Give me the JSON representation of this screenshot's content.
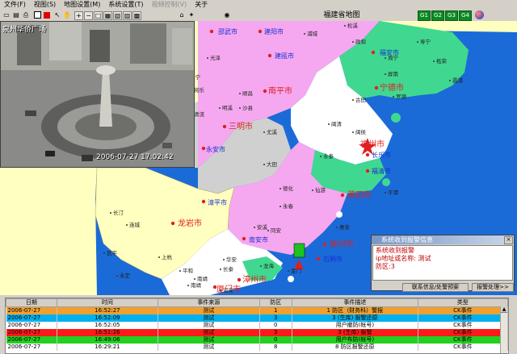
{
  "menu": [
    "文件(F)",
    "视图(S)",
    "地图设置(M)",
    "系统设置(T)",
    "视频控制(V)",
    "关于"
  ],
  "toolbar": {
    "icons": [
      "open-icon",
      "save-icon",
      "print-icon",
      "stop-icon",
      "record-icon",
      "pointer-icon",
      "pan-icon",
      "zoom-in-icon",
      "zoom-out-icon",
      "full-extent-icon",
      "layer-icon",
      "measure-icon",
      "identify-icon",
      "select-icon",
      "refresh-icon",
      "camera-icon",
      "target-icon"
    ],
    "map_title": "福建省地图",
    "green_buttons": [
      "G1",
      "G2",
      "G3",
      "G4"
    ]
  },
  "map": {
    "cities": [
      {
        "name": "邵武市",
        "color": "#1a2fd0"
      },
      {
        "name": "建阳市",
        "color": "#1a2fd0"
      },
      {
        "name": "建瓯市",
        "color": "#1a2fd0"
      },
      {
        "name": "福安市",
        "color": "#1a2fd0"
      },
      {
        "name": "南平市",
        "color": "#e02020"
      },
      {
        "name": "宁德市",
        "color": "#e02020"
      },
      {
        "name": "三明市",
        "color": "#e02020"
      },
      {
        "name": "永安市",
        "color": "#1a2fd0"
      },
      {
        "name": "福州市",
        "color": "#e02020"
      },
      {
        "name": "长乐市",
        "color": "#1a2fd0"
      },
      {
        "name": "福清市",
        "color": "#1a2fd0"
      },
      {
        "name": "莆田市",
        "color": "#e02020"
      },
      {
        "name": "漳平市",
        "color": "#1a2fd0"
      },
      {
        "name": "龙岩市",
        "color": "#e02020"
      },
      {
        "name": "泉州市",
        "color": "#e02020"
      },
      {
        "name": "南安市",
        "color": "#1a2fd0"
      },
      {
        "name": "石狮市",
        "color": "#1a2fd0"
      },
      {
        "name": "漳州市",
        "color": "#e02020"
      },
      {
        "name": "厦门市",
        "color": "#e02020"
      }
    ],
    "counties": [
      "松溪",
      "政和",
      "寿宁",
      "浦城",
      "光泽",
      "柘荣",
      "周宁",
      "霞浦",
      "屏南",
      "建宁",
      "泰宁",
      "将乐",
      "顺昌",
      "古田",
      "罗源",
      "闽清",
      "沙县",
      "尤溪",
      "闽侯",
      "宁化",
      "清流",
      "明溪",
      "永泰",
      "平潭",
      "大田",
      "德化",
      "永春",
      "仙游",
      "长汀",
      "连城",
      "安溪",
      "惠安",
      "武平",
      "上杭",
      "华安",
      "同安",
      "永定",
      "平和",
      "长泰",
      "南靖",
      "龙海",
      "南靖",
      "诏安",
      "金门"
    ]
  },
  "camera": {
    "label": "泉州华侨广场",
    "timestamp": "2006-07-27 17:02:42"
  },
  "alarm": {
    "title": "系统收到报警信息",
    "lines": [
      "系统收到报警",
      "ip地址或名称: 测试",
      "防区:3"
    ],
    "button1": "联系信息/处警预案",
    "button2": "报警处理>>"
  },
  "grid": {
    "headers": [
      "日期",
      "时间",
      "事件来源",
      "防区",
      "事件描述",
      "类型"
    ],
    "rows": [
      {
        "date": "2006-07-27",
        "time": "16:52:27",
        "source": "测试",
        "zone": "1",
        "desc": "1 防区（财务科）警报",
        "type": "CK事件",
        "bg": "#f0a030",
        "fg": "#000000"
      },
      {
        "date": "2006-07-27",
        "time": "16:52:09",
        "source": "测试",
        "zone": "3",
        "desc": "3 (生库) 报警还原",
        "type": "CK事件",
        "bg": "#00b0f0",
        "fg": "#000000"
      },
      {
        "date": "2006-07-27",
        "time": "16:52:05",
        "source": "测试",
        "zone": "0",
        "desc": "用户撤防(帐号)",
        "type": "CK事件",
        "bg": "#ffffff",
        "fg": "#000000"
      },
      {
        "date": "2006-07-27",
        "time": "16:51:26",
        "source": "测试",
        "zone": "3",
        "desc": "3 (生库) 报警",
        "type": "CK事件",
        "bg": "#ff1a1a",
        "fg": "#000000"
      },
      {
        "date": "2006-07-27",
        "time": "16:49:06",
        "source": "测试",
        "zone": "0",
        "desc": "用户布防(帐号)",
        "type": "CK事件",
        "bg": "#22d022",
        "fg": "#000000"
      },
      {
        "date": "2006-07-27",
        "time": "16:29:21",
        "source": "测试",
        "zone": "8",
        "desc": "8 防区报警还原",
        "type": "CK事件",
        "bg": "#ffffff",
        "fg": "#000000"
      }
    ]
  }
}
